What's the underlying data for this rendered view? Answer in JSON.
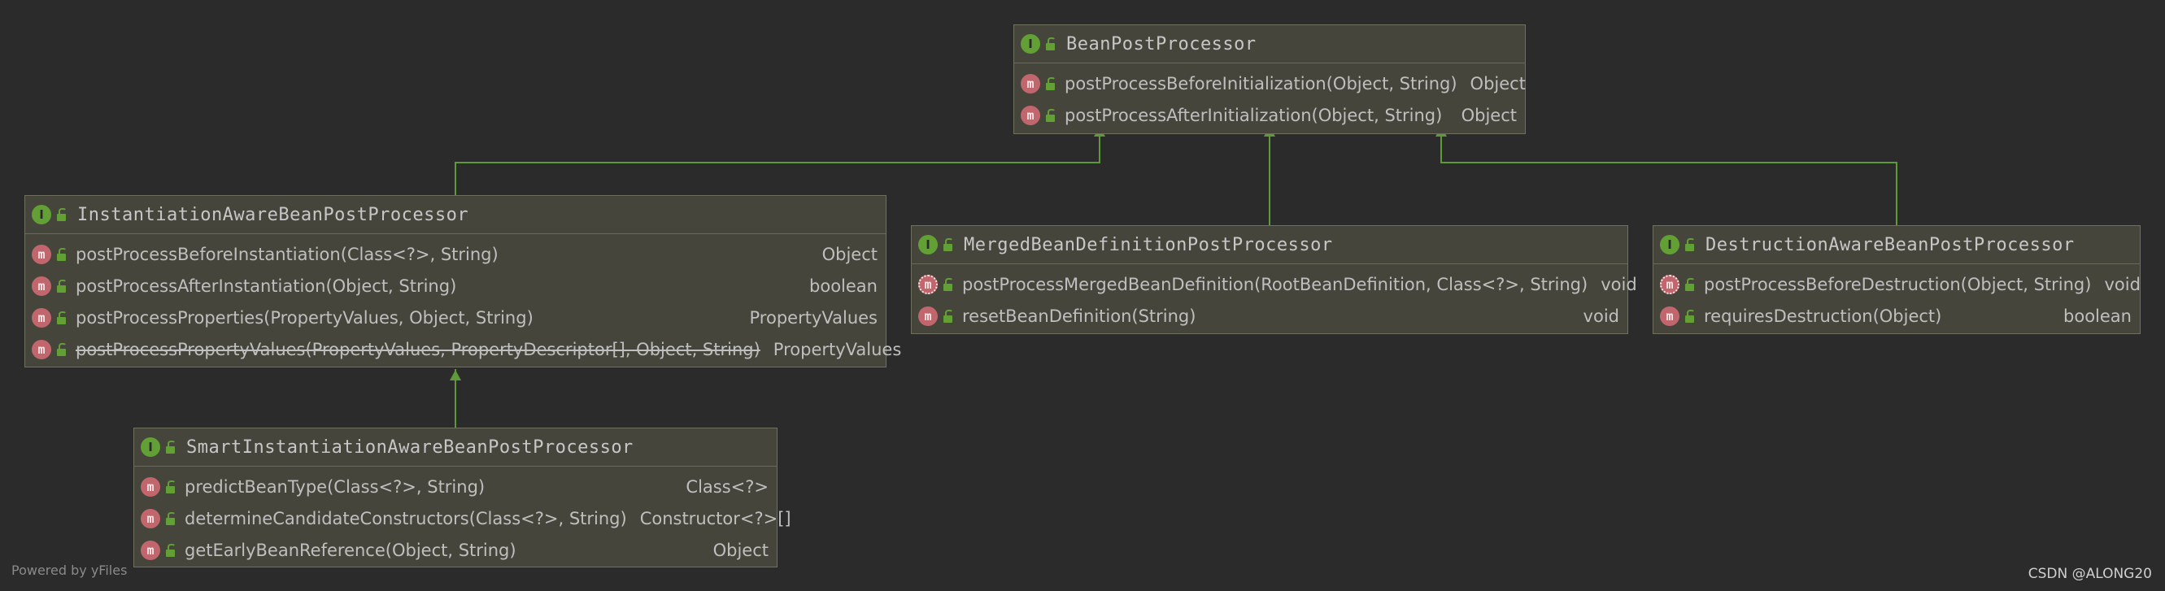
{
  "diagram": {
    "nodes": [
      {
        "id": "bpp",
        "title": "BeanPostProcessor",
        "methods": [
          {
            "sig": "postProcessBeforeInitialization(Object, String)",
            "ret": "Object"
          },
          {
            "sig": "postProcessAfterInitialization(Object, String)",
            "ret": "Object"
          }
        ]
      },
      {
        "id": "iabpp",
        "title": "InstantiationAwareBeanPostProcessor",
        "methods": [
          {
            "sig": "postProcessBeforeInstantiation(Class<?>, String)",
            "ret": "Object"
          },
          {
            "sig": "postProcessAfterInstantiation(Object, String)",
            "ret": "boolean"
          },
          {
            "sig": "postProcessProperties(PropertyValues, Object, String)",
            "ret": "PropertyValues"
          },
          {
            "sig": "postProcessPropertyValues(PropertyValues, PropertyDescriptor[], Object, String)",
            "ret": "PropertyValues",
            "deprecated": true
          }
        ]
      },
      {
        "id": "mbdpp",
        "title": "MergedBeanDefinitionPostProcessor",
        "methods": [
          {
            "sig": "postProcessMergedBeanDefinition(RootBeanDefinition, Class<?>, String)",
            "ret": "void",
            "abstract": true
          },
          {
            "sig": "resetBeanDefinition(String)",
            "ret": "void"
          }
        ]
      },
      {
        "id": "dabpp",
        "title": "DestructionAwareBeanPostProcessor",
        "methods": [
          {
            "sig": "postProcessBeforeDestruction(Object, String)",
            "ret": "void",
            "abstract": true
          },
          {
            "sig": "requiresDestruction(Object)",
            "ret": "boolean"
          }
        ]
      },
      {
        "id": "siabpp",
        "title": "SmartInstantiationAwareBeanPostProcessor",
        "methods": [
          {
            "sig": "predictBeanType(Class<?>, String)",
            "ret": "Class<?>"
          },
          {
            "sig": "determineCandidateConstructors(Class<?>, String)",
            "ret": "Constructor<?>[]"
          },
          {
            "sig": "getEarlyBeanReference(Object, String)",
            "ret": "Object"
          }
        ]
      }
    ],
    "edges": [
      {
        "from": "iabpp",
        "to": "bpp"
      },
      {
        "from": "mbdpp",
        "to": "bpp"
      },
      {
        "from": "dabpp",
        "to": "bpp"
      },
      {
        "from": "siabpp",
        "to": "iabpp"
      }
    ],
    "icons": {
      "interface": "interface-icon",
      "method": "method-icon",
      "visibility": "public-lock-icon"
    },
    "colors": {
      "edge": "#5e9a3a",
      "background": "#2b2b2b",
      "node": "#46453c"
    }
  },
  "footer": {
    "left": "Powered by yFiles",
    "right": "CSDN @ALONG20"
  }
}
